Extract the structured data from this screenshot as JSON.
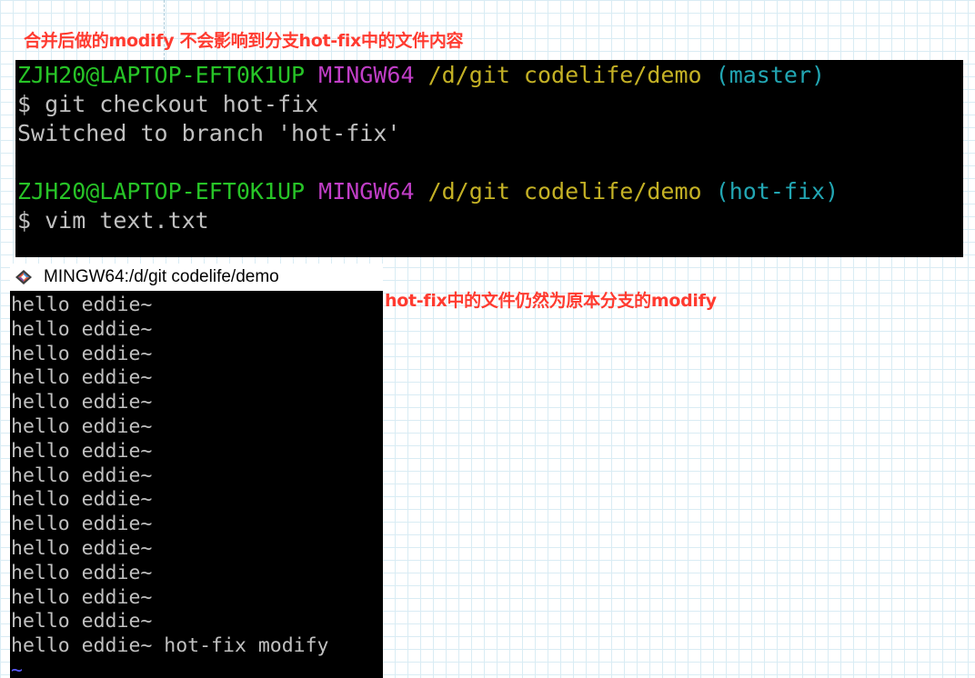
{
  "annotations": {
    "top": "合并后做的modify 不会影响到分支hot-fix中的文件内容",
    "middle": "hot-fix中的文件仍然为原本分支的modify"
  },
  "terminal_top": {
    "prompt1": {
      "user_host": "ZJH20@LAPTOP-EFT0K1UP",
      "env": "MINGW64",
      "path": "/d/git codelife/demo",
      "branch": "(master)"
    },
    "command1": "$ git checkout hot-fix",
    "output1": "Switched to branch 'hot-fix'",
    "prompt2": {
      "user_host": "ZJH20@LAPTOP-EFT0K1UP",
      "env": "MINGW64",
      "path": "/d/git codelife/demo",
      "branch": "(hot-fix)"
    },
    "command2": "$ vim text.txt"
  },
  "vim_window": {
    "title": "MINGW64:/d/git codelife/demo",
    "icon": "git-icon",
    "lines": [
      "hello eddie~",
      "hello eddie~",
      "hello eddie~",
      "hello eddie~",
      "hello eddie~",
      "hello eddie~",
      "hello eddie~",
      "hello eddie~",
      "hello eddie~",
      "hello eddie~",
      "hello eddie~",
      "hello eddie~",
      "hello eddie~",
      "hello eddie~",
      "hello eddie~ hot-fix modify"
    ],
    "tilde": "~"
  },
  "colors": {
    "annotation": "#ff3b30",
    "prompt_user": "#27c427",
    "prompt_env": "#c13ec7",
    "prompt_path": "#c4b125",
    "prompt_branch": "#22a6b3",
    "vim_tilde": "#5a5aff"
  }
}
